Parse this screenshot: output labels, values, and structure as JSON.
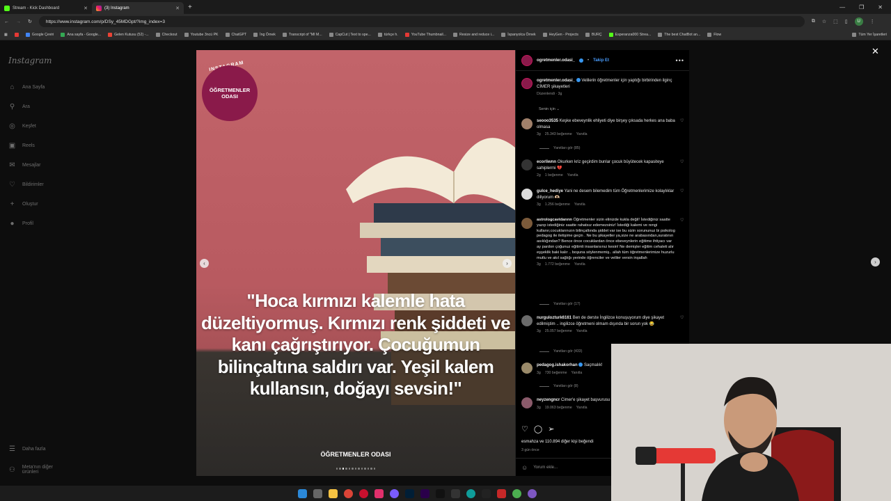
{
  "browser": {
    "tabs": [
      {
        "title": "Stream - Kick Dashboard",
        "active": false
      },
      {
        "title": "(3) Instagram",
        "active": true
      }
    ],
    "url": "https://www.instagram.com/p/DSy_45MDGpt/?img_index=3",
    "profile_initial": "U",
    "bookmarks": [
      "Google Çeviri",
      "Ana sayfa - Google...",
      "Gelen Kutusu (52) -...",
      "Checkout",
      "Youtube 3ncü PK",
      "ChatGPT",
      "İng Örnek",
      "Transcript of \"MI M...",
      "CapCut | Text to spe...",
      "türkçe h.",
      "YouTube Thumbnail...",
      "Resize and reduce i...",
      "İspanyolca Örnek",
      "HeyGen - Projects",
      "BURÇ",
      "Esperanza000 Strea...",
      "The best ChatBot an...",
      "Flow"
    ],
    "bookmarks_all": "Tüm Yer İşaretleri"
  },
  "sidebar": {
    "logo": "Instagram",
    "items": [
      {
        "label": "Ana Sayfa",
        "icon": "home-icon"
      },
      {
        "label": "Ara",
        "icon": "search-icon"
      },
      {
        "label": "Keşfet",
        "icon": "compass-icon"
      },
      {
        "label": "Reels",
        "icon": "reels-icon"
      },
      {
        "label": "Mesajlar",
        "icon": "messages-icon"
      },
      {
        "label": "Bildirimler",
        "icon": "heart-icon"
      },
      {
        "label": "Oluştur",
        "icon": "plus-icon"
      },
      {
        "label": "Profil",
        "icon": "profile-icon"
      }
    ],
    "more": "Daha fazla",
    "meta": "Meta'nın diğer ürünleri"
  },
  "post": {
    "badge_top": "INSTAGRAM",
    "badge_line1": "ÖĞRETMENLER",
    "badge_line2": "ODASI",
    "quote": "\"Hoca kırmızı kalemle hata düzeltiyormuş. Kırmızı renk şiddeti ve kanı çağrıştırıyor. Çocuğumun bilinçaltına saldırı var. Yeşil kalem kullansın, doğayı sevsin!\"",
    "brand": "ÖĞRETMENLER ODASI",
    "slide_count": 13,
    "current_slide": 3
  },
  "panel": {
    "username": "ogretmenler.odasi_",
    "follow": "Takip Et",
    "caption_user": "ogretmenler.odasi_",
    "caption": "Velilerin öğretmenler için yaptığı birbirinden ilginç CİMER şikayetleri",
    "caption_meta": "Düzenlendi · 3g",
    "sort": "Senin için",
    "comments": [
      {
        "user": "seooo3535",
        "text": "Keşke ebeveynlik ehliyeti diye birşey çıksada herkes ana baba olmasa",
        "time": "3g",
        "likes": "25.343 beğenme",
        "reply": "Yanıtla",
        "replies": "Yanıtları gör (85)"
      },
      {
        "user": "ecorliwnn",
        "text": "Okurken kriz geçirdim bunlar çocuk büyütecek kapasiteye sahiplermi 💔",
        "time": "2g",
        "likes": "1 beğenme",
        "reply": "Yanıtla",
        "replies": ""
      },
      {
        "user": "gulce_hediye",
        "text": "Yani ne desem bilemedim tüm Öğretmenlerimize kolaylıklar diliyorum 🫶🏻",
        "time": "3g",
        "likes": "1.256 beğenme",
        "reply": "Yanıtla",
        "replies": ""
      },
      {
        "user": "astrologcavidanrın",
        "text": "Öğretmenler sizin elinizde kukla değil! İstediğiniz saatte yazıp istediğiniz saatte rahatsız edemezsiniz! İstediği kalemi ve rengi kullanır,cocuklarınızın bilinçaltında şiddet var ise bu sizin sorununuz bi psikolog pedagog ile iletişime geçin . Ne bu şikayetler ya,size ne arabasından,suratının asıklığından? Bence önce cocuklardan önce ebeveynlerin eğitime ihtiyacı var ay pardon çoğunuz eğitimli insanlarsınız kesin! Ne demişler eğitim cehaleti alır eşşeklik baki kalır .. boşuna söylenmemiş.. allah tüm öğretmenlerimize huzurlu mutlu ve akıl sağlığı yerinde öğrenciler ve veliler versin inşallah",
        "time": "3g",
        "likes": "1.772 beğenme",
        "reply": "Yanıtla",
        "replies": "Yanıtları gör (17)"
      },
      {
        "user": "nurgulozturk6161",
        "text": "Ben de derste İngilizce konuşuyorum diye şikayet edilmiştim .. ingilizce öğretmeni olmam dışında bir sorun yok 😂",
        "time": "3g",
        "likes": "25.057 beğenme",
        "reply": "Yanıtla",
        "replies": "Yanıtları gör (433)"
      },
      {
        "user": "pedagog.ishakorhan",
        "text": "Saçmalık!",
        "time": "3g",
        "likes": "730 beğenme",
        "reply": "Yanıtla",
        "replies": "Yanıtları gör (8)"
      },
      {
        "user": "neyzengncr",
        "text": "Cimer'e şikayet başvurusu olur mu",
        "time": "3g",
        "likes": "19.063 beğenme",
        "reply": "Yanıtla",
        "replies": ""
      }
    ],
    "likes_line": "esmahza ve 110.894 diğer kişi beğendi",
    "ago": "3 gün önce",
    "add_comment": "Yorum ekle..."
  }
}
